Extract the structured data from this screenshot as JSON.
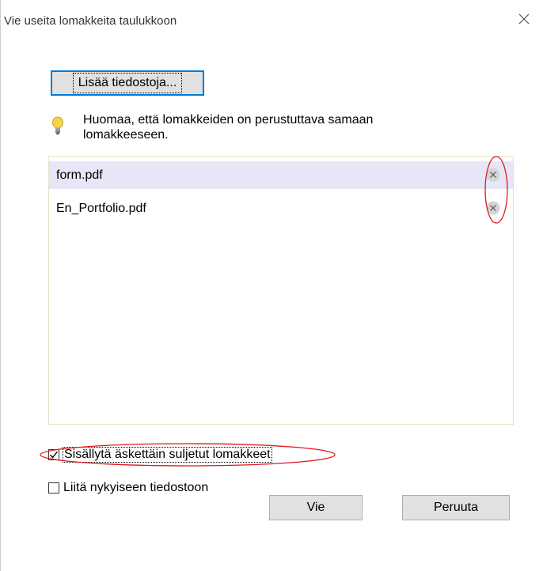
{
  "dialog": {
    "title": "Vie useita lomakkeita taulukkoon",
    "add_files_label": "Lisää tiedostoja...",
    "hint_text": "Huomaa, että lomakkeiden on perustuttava samaan lomakkeeseen.",
    "files": [
      {
        "name": "form.pdf"
      },
      {
        "name": "En_Portfolio.pdf"
      }
    ],
    "include_closed_label": "Sisällytä äskettäin suljetut lomakkeet",
    "include_closed_checked": true,
    "attach_current_label": "Liitä nykyiseen tiedostoon",
    "attach_current_checked": false,
    "export_label": "Vie",
    "cancel_label": "Peruuta"
  },
  "colors": {
    "accent": "#0078d7",
    "selection": "#e6e6f7",
    "annotation": "#e0191e"
  }
}
